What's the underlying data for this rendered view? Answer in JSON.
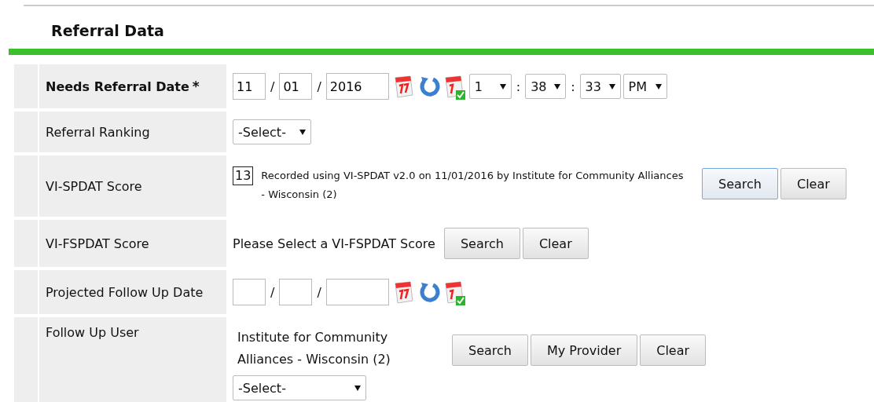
{
  "section": {
    "title": "Referral Data"
  },
  "rows": [
    {
      "kind": "datetime",
      "label": "Needs Referral Date",
      "bold": true,
      "required_mark": "*",
      "date": {
        "month": "11",
        "day": "01",
        "year": "2016",
        "separator": "/"
      },
      "time": {
        "hour": "1",
        "minute": "38",
        "second": "33",
        "ampm": "PM",
        "separator": ":"
      }
    },
    {
      "kind": "select",
      "label": "Referral Ranking",
      "bold": false,
      "select": "-Select-"
    },
    {
      "kind": "score",
      "label": "VI-SPDAT Score",
      "bold": false,
      "score": "13",
      "text": "Recorded using VI-SPDAT v2.0 on 11/01/2016 by Institute for Community Alliances - Wisconsin (2)",
      "buttons": [
        {
          "label": "Search",
          "focused": true
        },
        {
          "label": "Clear",
          "focused": false
        }
      ]
    },
    {
      "kind": "score",
      "label": "VI-FSPDAT Score",
      "bold": false,
      "text": "Please Select a VI-FSPDAT Score",
      "buttons": [
        {
          "label": "Search",
          "focused": false
        },
        {
          "label": "Clear",
          "focused": false
        }
      ]
    },
    {
      "kind": "date",
      "label": "Projected Follow Up Date",
      "bold": false,
      "date": {
        "separator": "/"
      }
    },
    {
      "kind": "user",
      "label": "Follow Up User",
      "bold": false,
      "text": "Institute for Community Alliances - Wisconsin (2)",
      "buttons": [
        {
          "label": "Search",
          "focused": false
        },
        {
          "label": "My Provider",
          "focused": false
        },
        {
          "label": "Clear",
          "focused": false
        }
      ],
      "select": "-Select-"
    }
  ]
}
